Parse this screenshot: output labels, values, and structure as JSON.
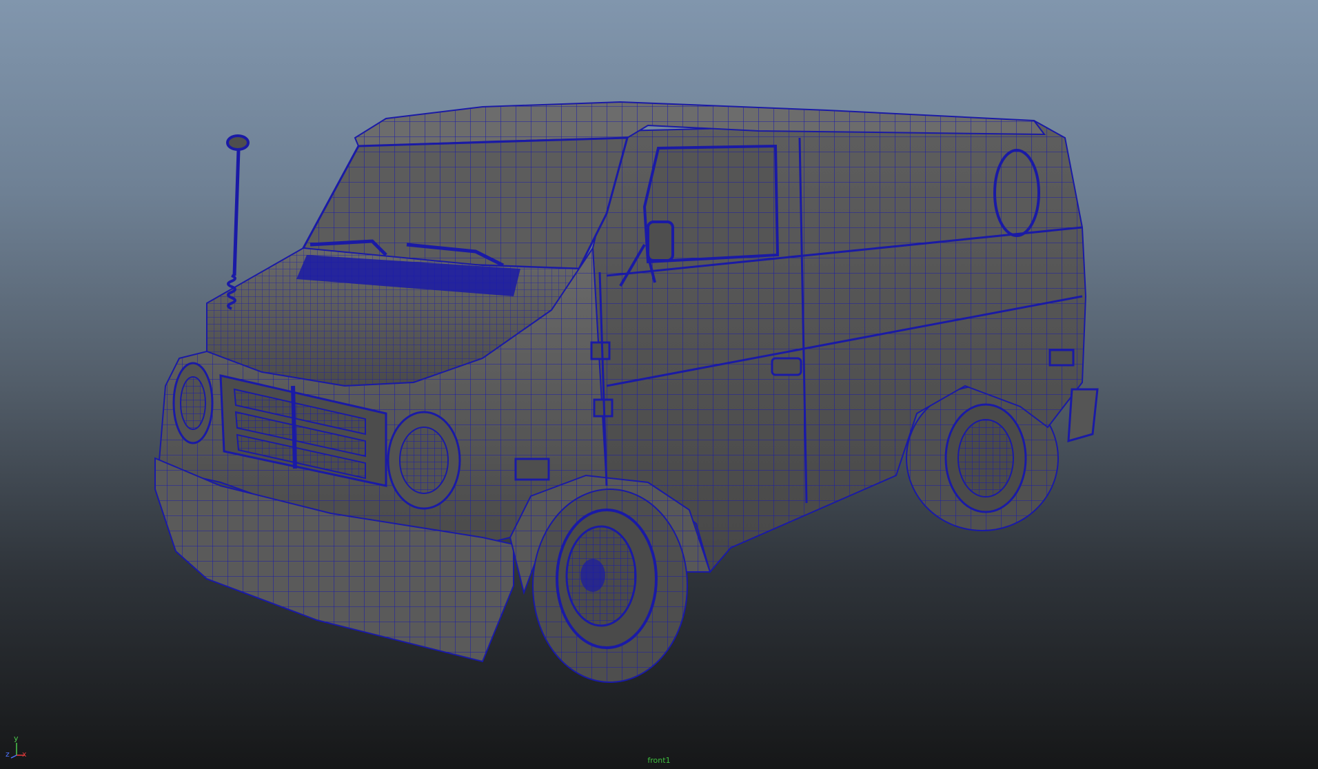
{
  "viewport": {
    "camera_name": "front1",
    "axes": {
      "y_label": "y",
      "z_label": "z",
      "x_label": "x",
      "y_color": "#4cc94c",
      "z_color": "#4f74ff",
      "x_color": "#e03b3b"
    },
    "wire_color": "#1a1aa6",
    "mesh_color": "#5a5a5a"
  }
}
